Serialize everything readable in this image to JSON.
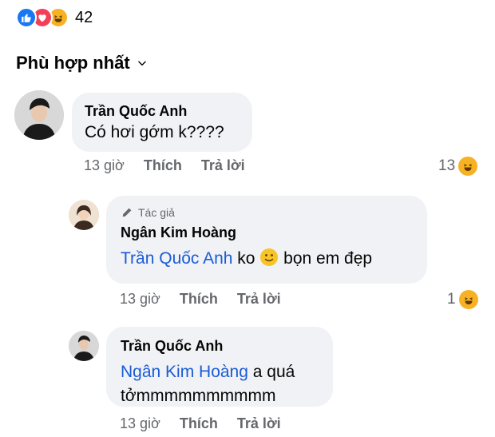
{
  "reactions": {
    "icons": [
      "like-icon",
      "love-icon",
      "haha-icon"
    ],
    "count": "42"
  },
  "sort": {
    "label": "Phù hợp nhất"
  },
  "comments": [
    {
      "author": "Trần Quốc Anh",
      "text": "Có hơi gớm k????",
      "time": "13 giờ",
      "like": "Thích",
      "reply": "Trả lời",
      "reaction_count": "13",
      "reaction_icon": "haha-icon"
    },
    {
      "badge": "Tác giả",
      "author": "Ngân Kim Hoàng",
      "mention": "Trần Quốc Anh",
      "text_before_emoji": " ko ",
      "emoji": "slightly-smiling-face",
      "text_after_emoji": " bọn em đẹp",
      "time": "13 giờ",
      "like": "Thích",
      "reply": "Trả lời",
      "reaction_count": "1",
      "reaction_icon": "haha-icon"
    },
    {
      "author": "Trần Quốc Anh",
      "mention": "Ngân Kim Hoàng",
      "text_after_mention": " a quá",
      "text_line2": "tởmmmmmmmmmm",
      "time": "13 giờ",
      "like": "Thích",
      "reply": "Trả lời"
    }
  ],
  "colors": {
    "bubble": "#f0f2f5",
    "mention": "#1a5bd6",
    "meta": "#65676b",
    "like": "#1877f2",
    "love": "#f33e58",
    "haha": "#f7b125"
  }
}
